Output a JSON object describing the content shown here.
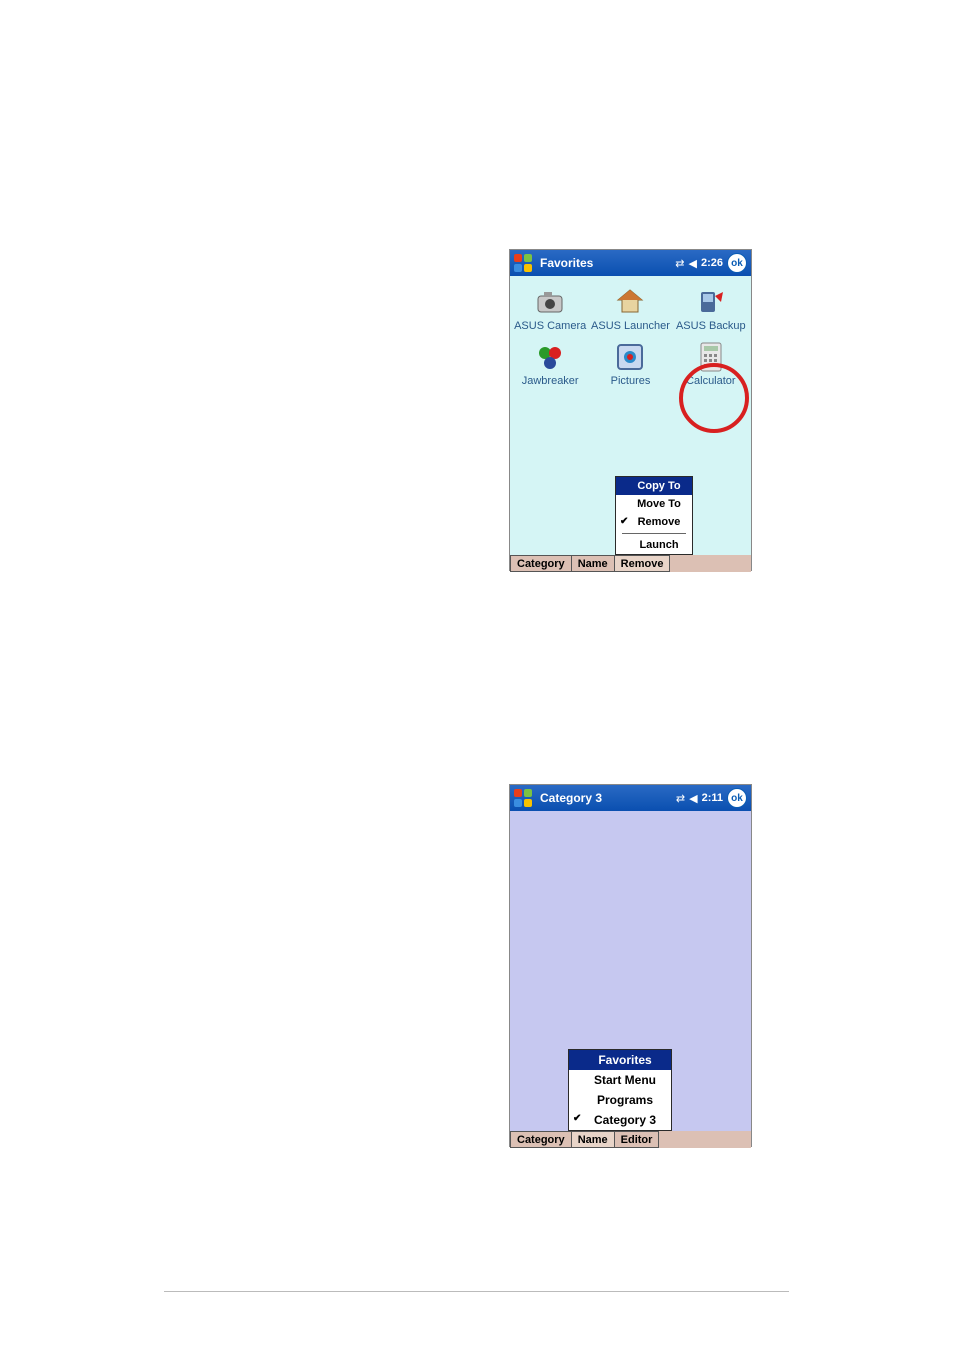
{
  "screen1": {
    "title": "Favorites",
    "time": "2:26",
    "ok": "ok",
    "apps": [
      {
        "name": "ASUS Camera",
        "icon": "camera"
      },
      {
        "name": "ASUS Launcher",
        "icon": "house"
      },
      {
        "name": "ASUS Backup",
        "icon": "backup"
      },
      {
        "name": "Jawbreaker",
        "icon": "balls"
      },
      {
        "name": "Pictures",
        "icon": "pictures"
      },
      {
        "name": "Calculator",
        "icon": "calculator"
      }
    ],
    "menu": {
      "items": [
        {
          "label": "Copy To",
          "highlight": true
        },
        {
          "label": "Move To"
        },
        {
          "label": "Remove",
          "checked": true
        },
        {
          "divider": true
        },
        {
          "label": "Launch"
        }
      ]
    },
    "bottom": {
      "category": "Category",
      "name": "Name",
      "remove": "Remove"
    }
  },
  "screen2": {
    "title": "Category 3",
    "time": "2:11",
    "ok": "ok",
    "menu": {
      "items": [
        {
          "label": "Favorites",
          "highlight": true
        },
        {
          "label": "Start Menu"
        },
        {
          "label": "Programs"
        },
        {
          "label": "Category 3",
          "checked": true
        }
      ]
    },
    "bottom": {
      "category": "Category",
      "name": "Name",
      "editor": "Editor"
    }
  }
}
